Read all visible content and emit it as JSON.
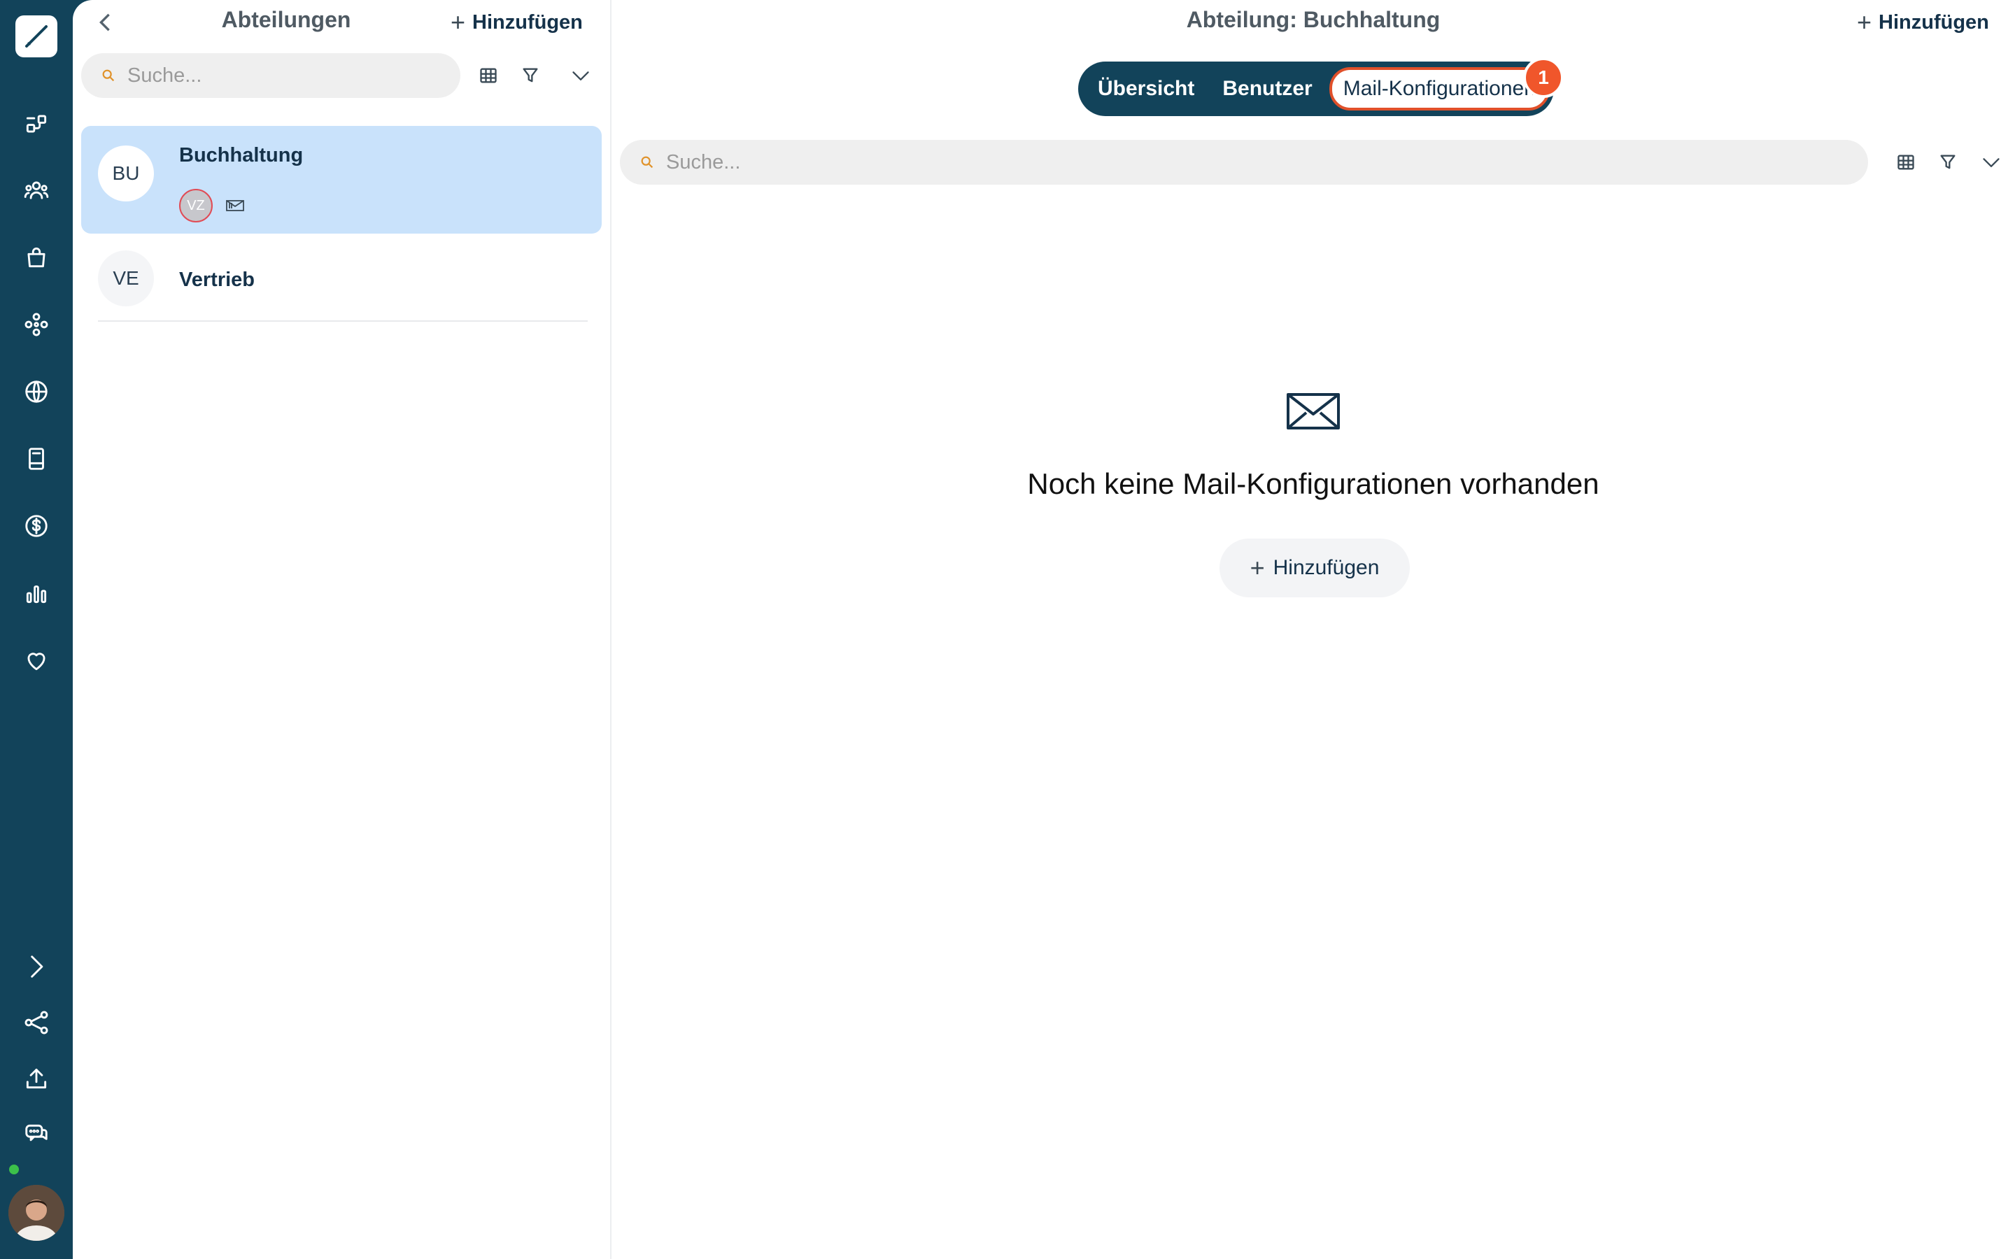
{
  "rail": {
    "icons": [
      "pen-logo-icon",
      "flow-icon",
      "users-group-icon",
      "shopping-bag-icon",
      "network-icon",
      "globe-icon",
      "book-icon",
      "dollar-icon",
      "bar-chart-icon",
      "heart-icon",
      "chevron-right-icon",
      "share-icon",
      "upload-icon",
      "chat-icon"
    ]
  },
  "list_panel": {
    "title": "Abteilungen",
    "add_label": "Hinzufügen",
    "search_placeholder": "Suche...",
    "departments": [
      {
        "initials": "BU",
        "name": "Buchhaltung",
        "badge": "VZ",
        "selected": true
      },
      {
        "initials": "VE",
        "name": "Vertrieb",
        "selected": false
      }
    ]
  },
  "main": {
    "title": "Abteilung: Buchhaltung",
    "add_label": "Hinzufügen",
    "tabs": [
      "Übersicht",
      "Benutzer",
      "Mail-Konfigurationen"
    ],
    "active_tab": "Mail-Konfigurationen",
    "step_badge": "1",
    "search_placeholder": "Suche...",
    "empty_message": "Noch keine Mail-Konfigurationen vorhanden",
    "empty_add_label": "Hinzufügen"
  },
  "colors": {
    "rail_bg": "#12435a",
    "selected_card": "#c9e2fb",
    "accent": "#f0562b"
  }
}
